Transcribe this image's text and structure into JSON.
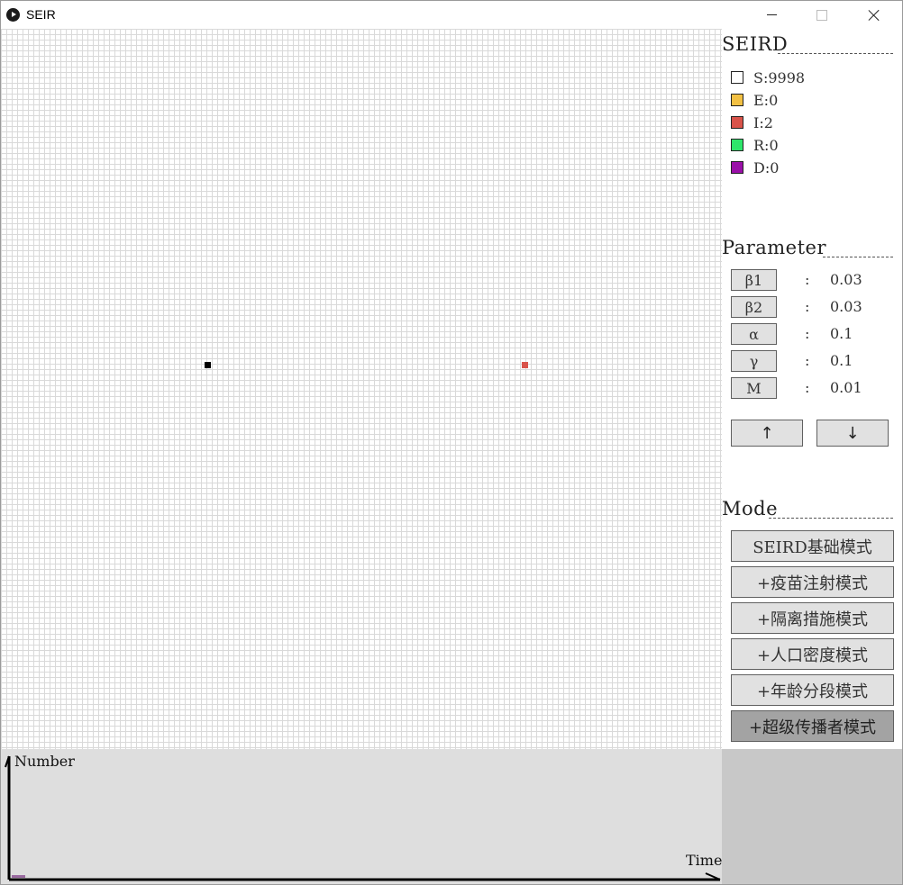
{
  "window": {
    "title": "SEIR",
    "icon": "play-icon",
    "controls": [
      "minimize-icon",
      "maximize-icon",
      "close-icon"
    ]
  },
  "simulation": {
    "agents": [
      {
        "state": "S",
        "color": "#000000"
      },
      {
        "state": "I",
        "color": "#d9534a"
      }
    ]
  },
  "legend": {
    "heading": "SEIRD",
    "items": [
      {
        "label": "S:9998",
        "color": "#ffffff"
      },
      {
        "label": "E:0",
        "color": "#f2c043"
      },
      {
        "label": "I:2",
        "color": "#d9534a"
      },
      {
        "label": "R:0",
        "color": "#2ee66b"
      },
      {
        "label": "D:0",
        "color": "#9a10a8"
      }
    ]
  },
  "parameters": {
    "heading": "Parameter",
    "items": [
      {
        "name": "β1",
        "colon": ":",
        "value": "0.03"
      },
      {
        "name": "β2",
        "colon": ":",
        "value": "0.03"
      },
      {
        "name": "α",
        "colon": ":",
        "value": "0.1"
      },
      {
        "name": "γ",
        "colon": ":",
        "value": "0.1"
      },
      {
        "name": "M",
        "colon": ":",
        "value": "0.01"
      }
    ],
    "up_label": "↑",
    "down_label": "↓"
  },
  "modes": {
    "heading": "Mode",
    "items": [
      {
        "label": "SEIRD基础模式",
        "active": false
      },
      {
        "label": "+疫苗注射模式",
        "active": false
      },
      {
        "label": "+隔离措施模式",
        "active": false
      },
      {
        "label": "+人口密度模式",
        "active": false
      },
      {
        "label": "+年龄分段模式",
        "active": false
      },
      {
        "label": "+超级传播者模式",
        "active": true
      }
    ]
  },
  "chart": {
    "y_label": "Number",
    "x_label": "Time",
    "background": "#dedede"
  }
}
